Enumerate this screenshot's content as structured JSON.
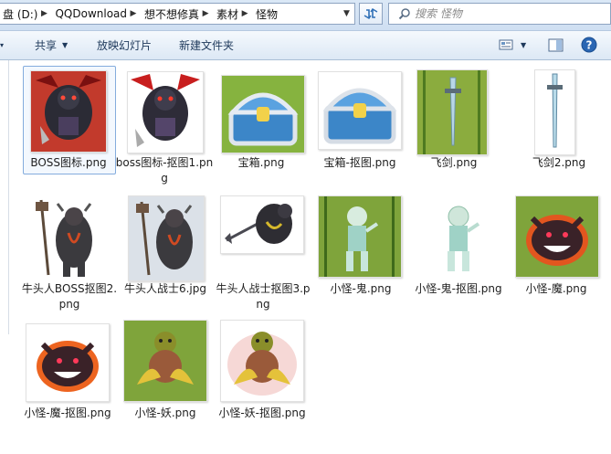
{
  "address": {
    "crumbs": [
      "盘 (D:)",
      "QQDownload",
      "想不想修真",
      "素材",
      "怪物"
    ]
  },
  "search": {
    "placeholder": "搜索 怪物"
  },
  "toolbar": {
    "share_label": "共享",
    "slideshow_label": "放映幻灯片",
    "new_folder_label": "新建文件夹"
  },
  "files": [
    {
      "name": "BOSS图标.png",
      "thumb": "boss-icon",
      "selected": true
    },
    {
      "name": "boss图标-抠图1.png",
      "thumb": "boss-icon-cutout",
      "selected": false
    },
    {
      "name": "宝箱.png",
      "thumb": "treasure-chest",
      "selected": false
    },
    {
      "name": "宝箱-抠图.png",
      "thumb": "treasure-chest-cutout",
      "selected": false
    },
    {
      "name": "飞剑.png",
      "thumb": "flying-sword",
      "selected": false
    },
    {
      "name": "飞剑2.png",
      "thumb": "flying-sword-2",
      "selected": false
    },
    {
      "name": "牛头人BOSS抠图2.png",
      "thumb": "minotaur-boss",
      "selected": false
    },
    {
      "name": "牛头人战士6.jpg",
      "thumb": "minotaur-warrior",
      "selected": false
    },
    {
      "name": "牛头人战士抠图3.png",
      "thumb": "minotaur-warrior-cutout",
      "selected": false
    },
    {
      "name": "小怪-鬼.png",
      "thumb": "ghost-monster",
      "selected": false
    },
    {
      "name": "小怪-鬼-抠图.png",
      "thumb": "ghost-monster-cutout",
      "selected": false
    },
    {
      "name": "小怪-魔.png",
      "thumb": "demon-monster",
      "selected": false
    },
    {
      "name": "小怪-魔-抠图.png",
      "thumb": "demon-monster-cutout",
      "selected": false
    },
    {
      "name": "小怪-妖.png",
      "thumb": "goblin-monster",
      "selected": false
    },
    {
      "name": "小怪-妖-抠图.png",
      "thumb": "goblin-monster-cutout",
      "selected": false
    }
  ]
}
